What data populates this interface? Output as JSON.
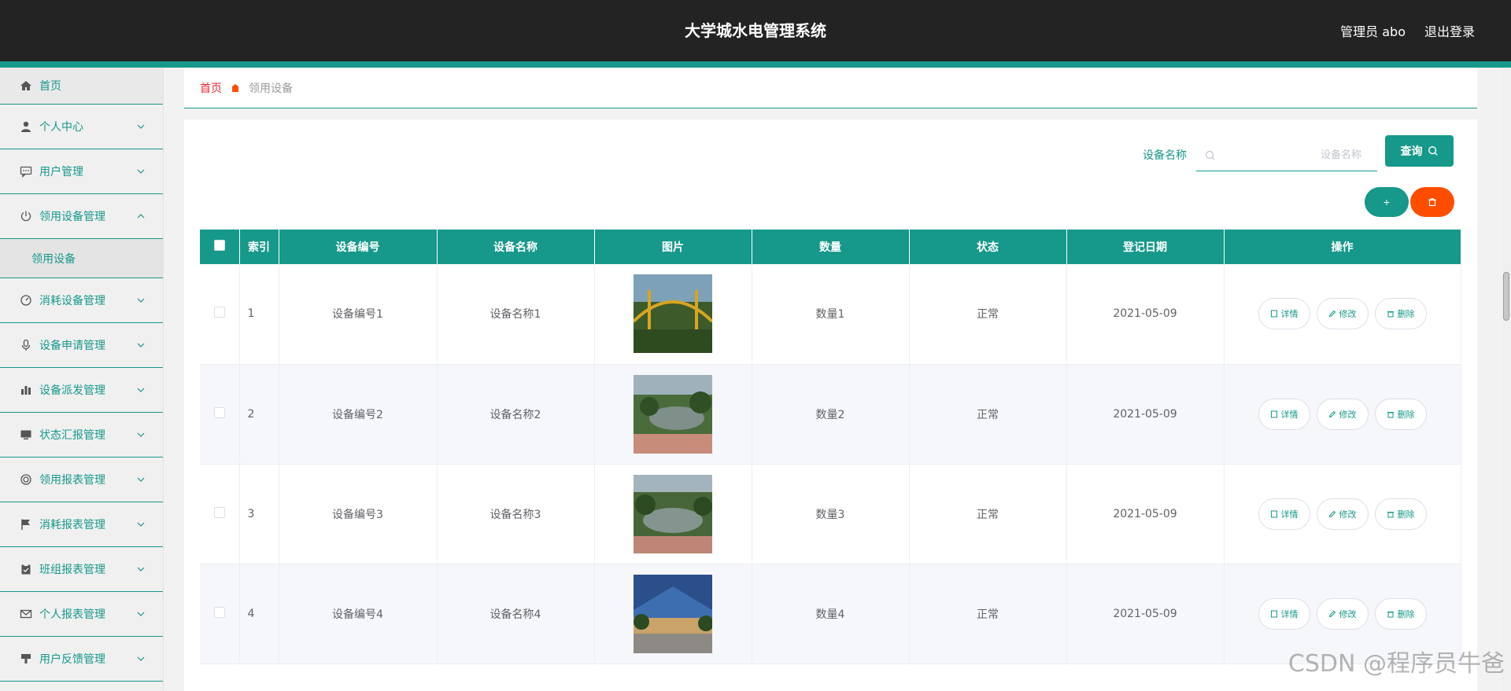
{
  "header": {
    "title": "大学城水电管理系统",
    "user": "管理员 abo",
    "logout": "退出登录"
  },
  "sidebar": {
    "items": [
      {
        "label": "首页",
        "icon": "home-icon"
      },
      {
        "label": "个人中心",
        "icon": "user-icon"
      },
      {
        "label": "用户管理",
        "icon": "chat-icon"
      },
      {
        "label": "领用设备管理",
        "icon": "power-icon",
        "expanded": true
      },
      {
        "label": "消耗设备管理",
        "icon": "gauge-icon"
      },
      {
        "label": "设备申请管理",
        "icon": "microphone-icon"
      },
      {
        "label": "设备派发管理",
        "icon": "bar-chart-icon"
      },
      {
        "label": "状态汇报管理",
        "icon": "monitor-icon"
      },
      {
        "label": "领用报表管理",
        "icon": "target-icon"
      },
      {
        "label": "消耗报表管理",
        "icon": "flag-icon"
      },
      {
        "label": "班组报表管理",
        "icon": "clipboard-icon"
      },
      {
        "label": "个人报表管理",
        "icon": "mail-icon"
      },
      {
        "label": "用户反馈管理",
        "icon": "brush-icon"
      }
    ],
    "submenu": {
      "label": "领用设备"
    }
  },
  "breadcrumb": {
    "home": "首页",
    "current": "领用设备"
  },
  "search": {
    "label": "设备名称",
    "placeholder": "设备名称",
    "value": "",
    "button": "查询"
  },
  "actions": {
    "add": "+",
    "delete": "delete"
  },
  "table": {
    "headers": [
      "索引",
      "设备编号",
      "设备名称",
      "图片",
      "数量",
      "状态",
      "登记日期",
      "操作"
    ],
    "rows": [
      {
        "index": "1",
        "code": "设备编号1",
        "name": "设备名称1",
        "qty": "数量1",
        "status": "正常",
        "date": "2021-05-09"
      },
      {
        "index": "2",
        "code": "设备编号2",
        "name": "设备名称2",
        "qty": "数量2",
        "status": "正常",
        "date": "2021-05-09"
      },
      {
        "index": "3",
        "code": "设备编号3",
        "name": "设备名称3",
        "qty": "数量3",
        "status": "正常",
        "date": "2021-05-09"
      },
      {
        "index": "4",
        "code": "设备编号4",
        "name": "设备名称4",
        "qty": "数量4",
        "status": "正常",
        "date": "2021-05-09"
      }
    ],
    "ops": {
      "detail": "详情",
      "edit": "修改",
      "delete": "删除"
    }
  },
  "watermark": "CSDN @程序员牛爸",
  "colors": {
    "primary": "#16988a",
    "danger": "#ff4d00",
    "header_bg": "#232323"
  }
}
